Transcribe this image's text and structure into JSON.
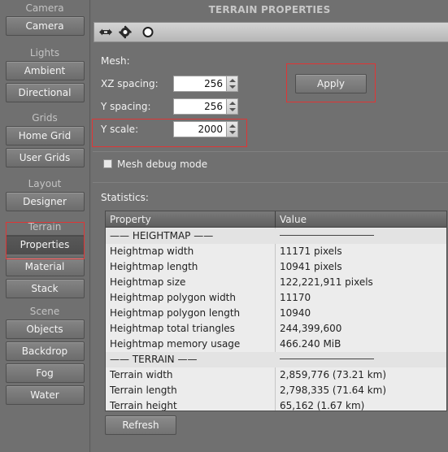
{
  "sidebar": {
    "sections": [
      {
        "title": "Camera",
        "buttons": [
          "Camera"
        ]
      },
      {
        "title": "Lights",
        "buttons": [
          "Ambient",
          "Directional"
        ]
      },
      {
        "title": "Grids",
        "buttons": [
          "Home Grid",
          "User Grids"
        ]
      },
      {
        "title": "Layout",
        "buttons": [
          "Designer"
        ]
      },
      {
        "title": "Terrain",
        "buttons": [
          "Properties",
          "Material",
          "Stack"
        ]
      },
      {
        "title": "Scene",
        "buttons": [
          "Objects",
          "Backdrop",
          "Fog",
          "Water"
        ]
      }
    ],
    "active_button": "Properties"
  },
  "panel": {
    "title": "TERRAIN PROPERTIES",
    "toolbar": [
      "expand-icon",
      "settings-icon",
      "circle-icon"
    ],
    "mesh_label": "Mesh:",
    "xz_spacing_label": "XZ spacing:",
    "xz_spacing_value": "256",
    "y_spacing_label": "Y spacing:",
    "y_spacing_value": "256",
    "y_scale_label": "Y scale:",
    "y_scale_value": "2000",
    "apply_label": "Apply",
    "mesh_debug_label": "Mesh debug mode",
    "mesh_debug_checked": false,
    "statistics_label": "Statistics:",
    "refresh_label": "Refresh"
  },
  "table": {
    "headers": [
      "Property",
      "Value"
    ],
    "rows": [
      {
        "property": "—— HEIGHTMAP ——",
        "value": "",
        "separator": true
      },
      {
        "property": "Heightmap width",
        "value": "11171 pixels"
      },
      {
        "property": "Heightmap length",
        "value": "10941 pixels"
      },
      {
        "property": "Heightmap size",
        "value": "122,221,911 pixels"
      },
      {
        "property": "Heightmap polygon width",
        "value": "11170"
      },
      {
        "property": "Heightmap polygon length",
        "value": "10940"
      },
      {
        "property": "Heightmap total triangles",
        "value": "244,399,600"
      },
      {
        "property": "Heightmap memory usage",
        "value": "466.240 MiB"
      },
      {
        "property": "—— TERRAIN ——",
        "value": "",
        "separator": true
      },
      {
        "property": "Terrain width",
        "value": "2,859,776 (73.21 km)"
      },
      {
        "property": "Terrain length",
        "value": "2,798,335 (71.64 km)"
      },
      {
        "property": "Terrain height",
        "value": "65,162 (1.67 km)"
      }
    ]
  },
  "colors": {
    "highlight_box": "#e03535",
    "background": "#707070"
  }
}
